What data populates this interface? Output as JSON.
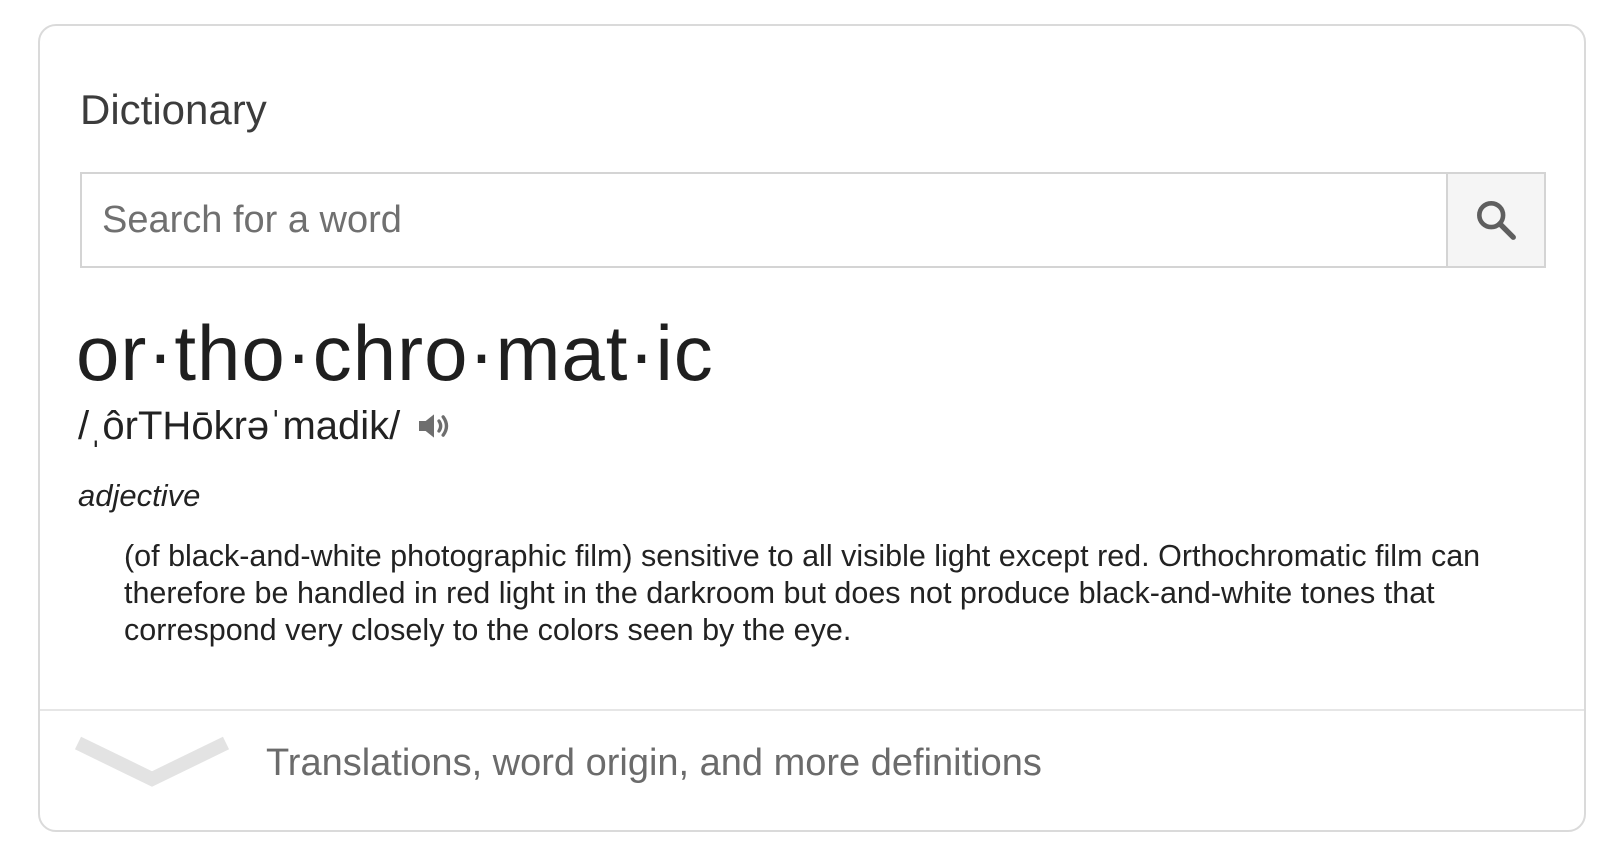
{
  "card": {
    "title": "Dictionary"
  },
  "search": {
    "placeholder": "Search for a word",
    "button_icon": "search-icon"
  },
  "entry": {
    "headword": "or·tho·chro·mat·ic",
    "phonetic": "/ˌôrTHōkrəˈmadik/",
    "audio_icon": "speaker-icon",
    "part_of_speech": "adjective",
    "definition": "(of black-and-white photographic film) sensitive to all visible light except red. Orthochromatic film can therefore be handled in red light in the darkroom but does not produce black-and-white tones that correspond very closely to the colors seen by the eye."
  },
  "more": {
    "icon": "chevron-down-icon",
    "label": "Translations, word origin, and more definitions"
  },
  "colors": {
    "border": "#dadada",
    "text": "#222222",
    "muted": "#6b6b6b",
    "chevron": "#e3e3e3"
  }
}
